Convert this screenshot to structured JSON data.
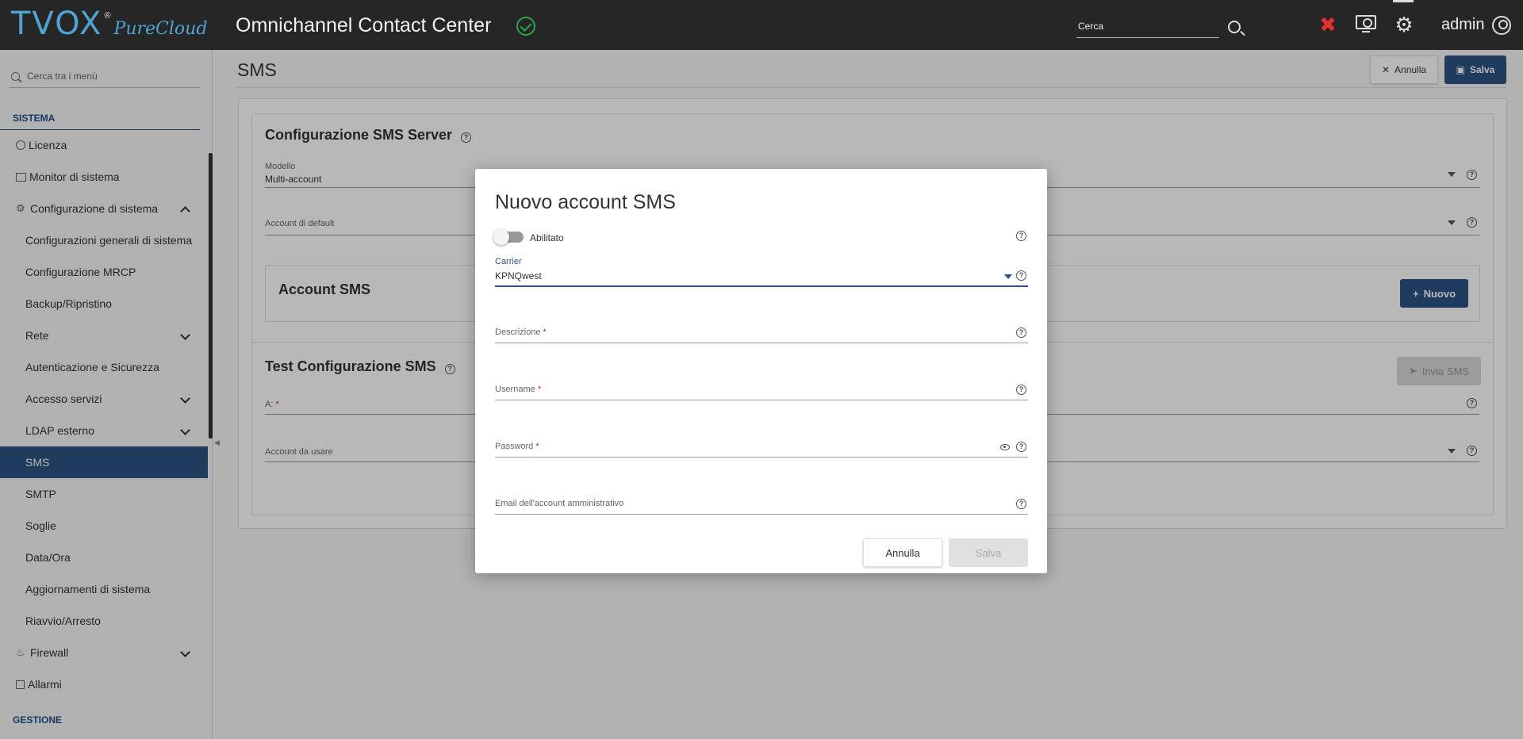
{
  "header": {
    "logo_text": "TVOX",
    "logo_reg": "®",
    "logo_sub": "PureCloud",
    "app_title": "Omnichannel Contact Center",
    "search_placeholder": "Cerca",
    "user": "admin"
  },
  "sidebar": {
    "search_placeholder": "Cerca tra i menù",
    "section_sistema": "SISTEMA",
    "section_gestione": "GESTIONE",
    "items": [
      {
        "label": "Licenza"
      },
      {
        "label": "Monitor di sistema"
      },
      {
        "label": "Configurazione di sistema"
      },
      {
        "label": "Configurazioni generali di sistema"
      },
      {
        "label": "Configurazione MRCP"
      },
      {
        "label": "Backup/Ripristino"
      },
      {
        "label": "Rete"
      },
      {
        "label": "Autenticazione e Sicurezza"
      },
      {
        "label": "Accesso servizi"
      },
      {
        "label": "LDAP esterno"
      },
      {
        "label": "SMS"
      },
      {
        "label": "SMTP"
      },
      {
        "label": "Soglie"
      },
      {
        "label": "Data/Ora"
      },
      {
        "label": "Aggiornamenti di sistema"
      },
      {
        "label": "Riavvio/Arresto"
      },
      {
        "label": "Firewall"
      },
      {
        "label": "Allarmi"
      }
    ]
  },
  "main": {
    "title": "SMS",
    "btn_annulla": "Annulla",
    "btn_salva": "Salva",
    "server_card": {
      "title": "Configurazione SMS Server",
      "modello_label": "Modello",
      "modello_value": "Multi-account",
      "account_default_label": "Account di default"
    },
    "account_card": {
      "title": "Account SMS",
      "btn_nuovo": "Nuovo"
    },
    "test_card": {
      "title": "Test Configurazione SMS",
      "a_label": "A:",
      "account_label": "Account da usare",
      "btn_invia": "Invia SMS"
    }
  },
  "modal": {
    "title": "Nuovo account SMS",
    "toggle_label": "Abilitato",
    "carrier_label": "Carrier",
    "carrier_value": "KPNQwest",
    "descrizione_label": "Descrizione",
    "username_label": "Username",
    "password_label": "Password",
    "email_label": "Email dell'account amministrativo",
    "required_mark": "*",
    "btn_annulla": "Annulla",
    "btn_salva": "Salva"
  },
  "colors": {
    "primary": "#2c5282",
    "header_bg": "#262626",
    "success": "#27a845",
    "alert": "#e03030"
  }
}
